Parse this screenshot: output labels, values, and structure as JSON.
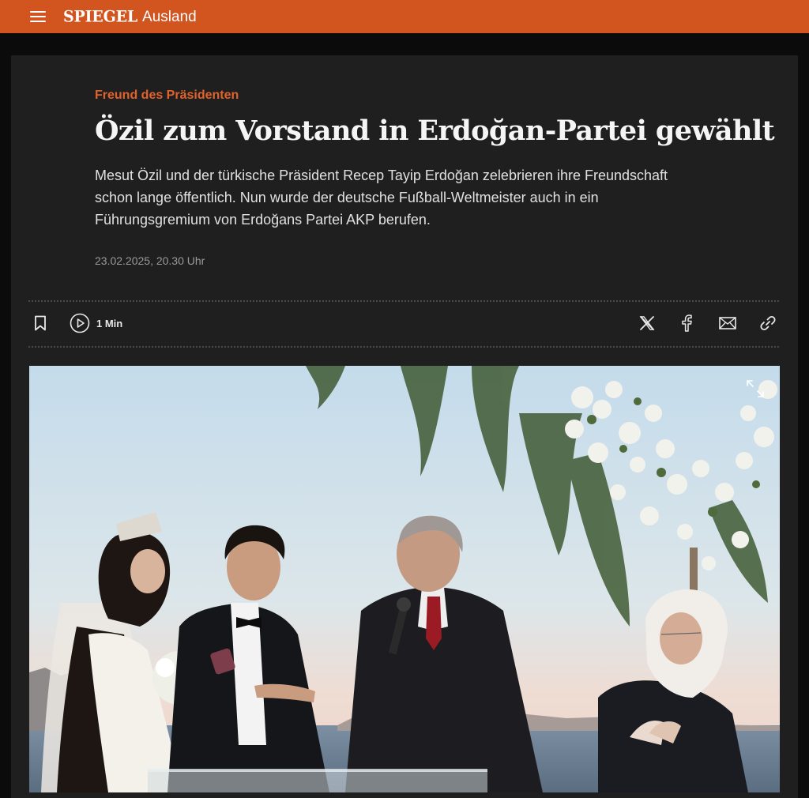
{
  "header": {
    "brand": "SPIEGEL",
    "section": "Ausland",
    "bar_color": "#d2541f",
    "menu_icon": "hamburger-icon"
  },
  "article": {
    "kicker": "Freund des Präsidenten",
    "headline": "Özil zum Vorstand in Erdoğan-Partei gewählt",
    "teaser": "Mesut Özil und der türkische Präsident Recep Tayip Erdoğan zelebrieren ihre Freundschaft schon lange öffentlich. Nun wurde der deutsche Fußball-Weltmeister auch in ein Führungsgremium von Erdoğans Partei AKP berufen.",
    "date": "23.02.2025, 20.30 Uhr",
    "accent_color": "#e2622b"
  },
  "toolbar": {
    "bookmark_icon": "bookmark-icon",
    "audio_icon": "play-circle-icon",
    "audio_label": "1 Min",
    "share_icons": [
      "x-icon",
      "facebook-icon",
      "mail-icon",
      "link-icon"
    ]
  },
  "photo": {
    "expand_icon": "expand-icon",
    "scene": "wedding-ceremony"
  }
}
